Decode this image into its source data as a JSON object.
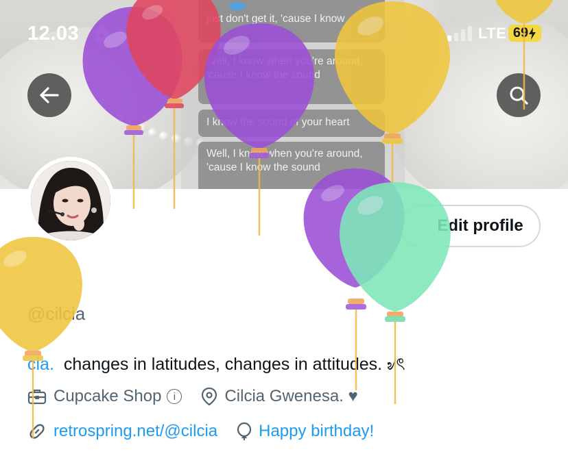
{
  "status_bar": {
    "time": "12.03",
    "network": "LTE",
    "battery": "69"
  },
  "banner": {
    "lyrics": [
      "just don't get it, 'cause I know",
      "Well, I know when you're around, 'cause I know the sound",
      "I know the sound of your heart",
      "Well, I know when you're around, 'cause I know the sound"
    ]
  },
  "header": {
    "back_icon": "arrow-left-icon",
    "search_icon": "search-icon"
  },
  "profile": {
    "edit_label": "Edit profile",
    "handle": "@cilcia",
    "bio_mention": "cia.",
    "bio_text": "changes in latitudes, changes in attitudes. ৶ৎ",
    "category": "Cupcake Shop",
    "location": "Cilcia Gwenesa. ♥",
    "website": "retrospring.net/@cilcia",
    "birthday": "Happy birthday!"
  },
  "colors": {
    "accent": "#1d9bf0",
    "secondary_text": "#536471",
    "balloon_purple": "#9b4fd6",
    "balloon_red": "#e0455f",
    "balloon_yellow": "#f0c63d",
    "balloon_green": "#7ee8b8"
  }
}
